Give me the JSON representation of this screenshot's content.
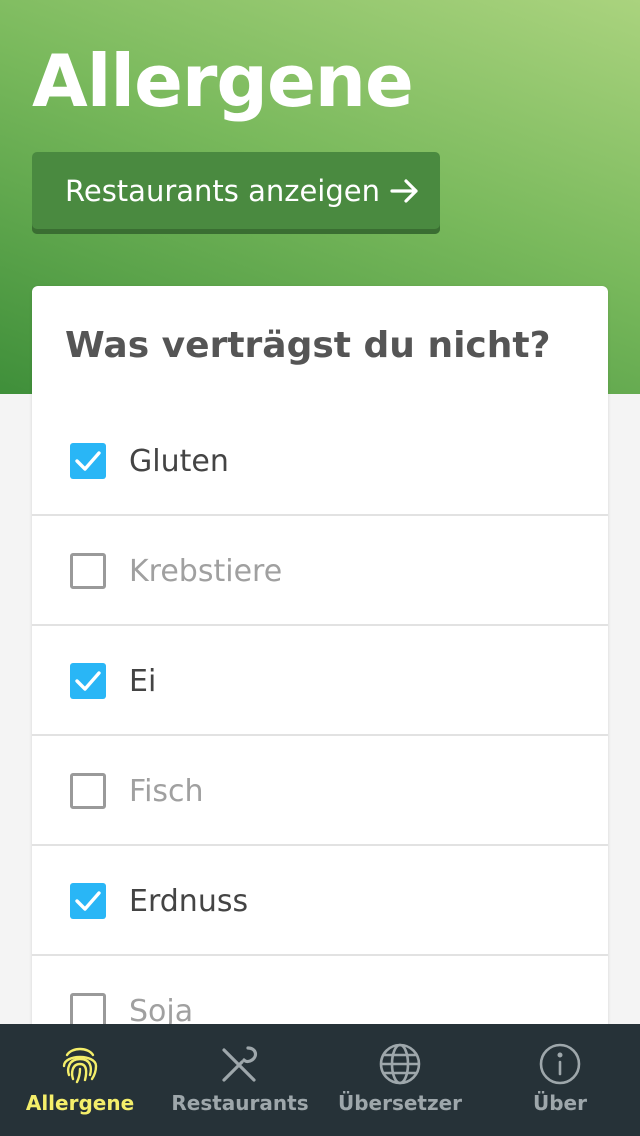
{
  "header": {
    "title": "Allergene",
    "cta_label": "Restaurants anzeigen"
  },
  "card": {
    "question": "Was verträgst du nicht?",
    "items": [
      {
        "label": "Gluten",
        "checked": true
      },
      {
        "label": "Krebstiere",
        "checked": false
      },
      {
        "label": "Ei",
        "checked": true
      },
      {
        "label": "Fisch",
        "checked": false
      },
      {
        "label": "Erdnuss",
        "checked": true
      },
      {
        "label": "Soja",
        "checked": false
      }
    ]
  },
  "tabbar": {
    "tabs": [
      {
        "label": "Allergene",
        "icon": "fingerprint-icon",
        "active": true
      },
      {
        "label": "Restaurants",
        "icon": "cutlery-icon",
        "active": false
      },
      {
        "label": "Übersetzer",
        "icon": "globe-icon",
        "active": false
      },
      {
        "label": "Über",
        "icon": "info-icon",
        "active": false
      }
    ]
  },
  "colors": {
    "accent": "#29b6f6",
    "active_tab": "#f4ee6a",
    "tabbar_bg": "#263238",
    "header_green": "#4a8a40"
  }
}
